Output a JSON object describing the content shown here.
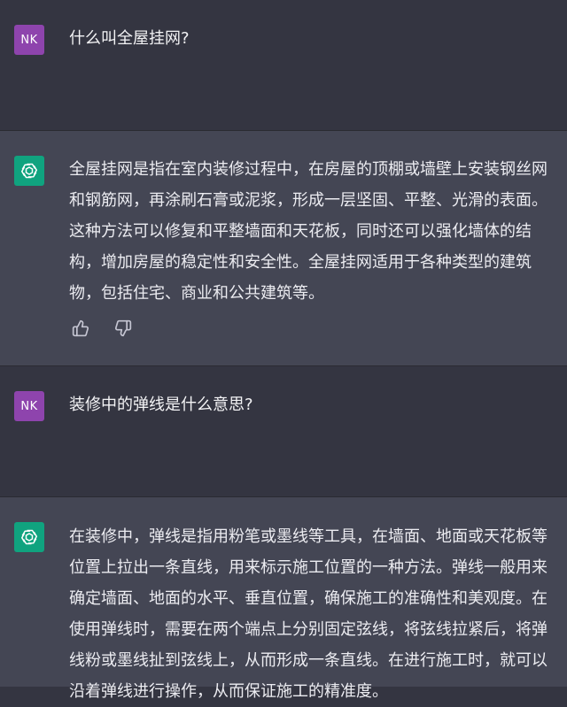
{
  "conversation": [
    {
      "role": "user",
      "avatar_initials": "NK",
      "text": "什么叫全屋挂网?"
    },
    {
      "role": "assistant",
      "avatar_icon": "openai-logo-icon",
      "text": "全屋挂网是指在室内装修过程中，在房屋的顶棚或墙壁上安装钢丝网和钢筋网，再涂刷石膏或泥浆，形成一层坚固、平整、光滑的表面。这种方法可以修复和平整墙面和天花板，同时还可以强化墙体的结构，增加房屋的稳定性和安全性。全屋挂网适用于各种类型的建筑物，包括住宅、商业和公共建筑等。",
      "feedback": [
        "thumbs-up-icon",
        "thumbs-down-icon"
      ]
    },
    {
      "role": "user",
      "avatar_initials": "NK",
      "text": "装修中的弹线是什么意思?"
    },
    {
      "role": "assistant",
      "avatar_icon": "openai-logo-icon",
      "text": "在装修中，弹线是指用粉笔或墨线等工具，在墙面、地面或天花板等位置上拉出一条直线，用来标示施工位置的一种方法。弹线一般用来确定墙面、地面的水平、垂直位置，确保施工的准确性和美观度。在使用弹线时，需要在两个端点上分别固定弦线，将弦线拉紧后，将弹线粉或墨线扯到弦线上，从而形成一条直线。在进行施工时，就可以沿着弹线进行操作，从而保证施工的精准度。"
    }
  ],
  "colors": {
    "background_user": "#343541",
    "background_assistant": "#444654",
    "avatar_user": "#8e44ad",
    "avatar_assistant": "#10a37f",
    "text": "#ececf1"
  }
}
